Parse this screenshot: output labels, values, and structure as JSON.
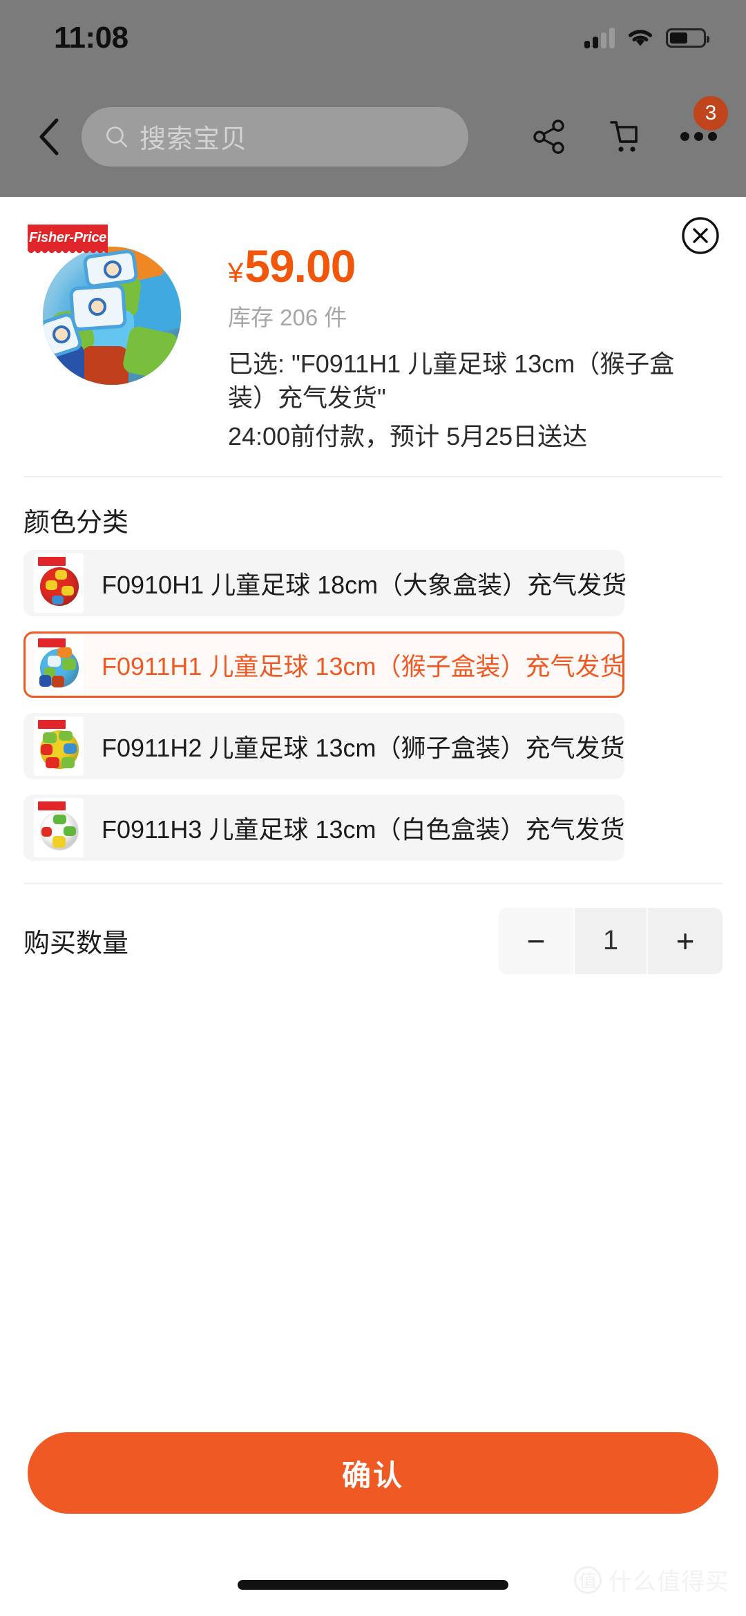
{
  "status_bar": {
    "time": "11:08",
    "signal_icon": "cellular-signal-icon",
    "wifi_icon": "wifi-icon",
    "battery_icon": "battery-icon",
    "battery_level_percent": 55
  },
  "nav_bar": {
    "back_icon": "chevron-left-icon",
    "search": {
      "icon": "search-icon",
      "placeholder": "搜索宝贝",
      "value": ""
    },
    "share_icon": "share-icon",
    "cart_icon": "shopping-cart-icon",
    "more_icon": "more-dots-icon",
    "more_badge_count": "3"
  },
  "sheet": {
    "close_icon": "close-circle-icon",
    "brand_logo_text": "Fisher-Price",
    "product_image": "childrens-soccer-ball-monkey",
    "price": {
      "currency_symbol": "¥",
      "amount": "59.00"
    },
    "stock_text": "库存 206 件",
    "selected_text": "已选: \"F0911H1 儿童足球 13cm（猴子盒装）充气发货\"",
    "delivery_text": "24:00前付款，预计 5月25日送达",
    "color_section": {
      "title": "颜色分类",
      "options": [
        {
          "label": "F0910H1 儿童足球 18cm（大象盒装）充气发货",
          "thumb": "ball-red-elephant",
          "selected": false
        },
        {
          "label": "F0911H1 儿童足球 13cm（猴子盒装）充气发货",
          "thumb": "ball-multicolor-monkey",
          "selected": true
        },
        {
          "label": "F0911H2 儿童足球 13cm（狮子盒装）充气发货",
          "thumb": "ball-yellow-lion",
          "selected": false
        },
        {
          "label": "F0911H3 儿童足球 13cm（白色盒装）充气发货",
          "thumb": "ball-white",
          "selected": false
        }
      ]
    },
    "quantity": {
      "label": "购买数量",
      "value": "1",
      "minus_label": "−",
      "plus_label": "+"
    },
    "confirm_label": "确认"
  },
  "watermark": {
    "mark": "值",
    "text": "什么值得买"
  },
  "colors": {
    "accent_orange": "#ef5a24",
    "price_orange": "#f2560a",
    "badge_red": "#c0451c",
    "brand_red": "#e0252b",
    "overlay_gray": "#7b7b7b",
    "option_bg": "#f5f5f5"
  }
}
